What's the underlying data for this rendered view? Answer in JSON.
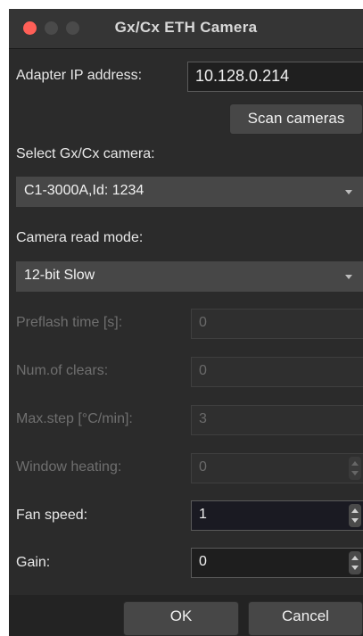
{
  "window": {
    "title": "Gx/Cx ETH Camera"
  },
  "adapter": {
    "label": "Adapter IP address:",
    "value": "10.128.0.214"
  },
  "scan_button_label": "Scan cameras",
  "camera_select": {
    "label": "Select Gx/Cx camera:",
    "selected": "C1-3000A,Id: 1234"
  },
  "read_mode": {
    "label": "Camera read mode:",
    "selected": "12-bit Slow"
  },
  "fields": {
    "preflash": {
      "label": "Preflash time [s]:",
      "value": "0"
    },
    "clears": {
      "label": "Num.of clears:",
      "value": "0"
    },
    "max_step": {
      "label": "Max.step [°C/min]:",
      "value": "3"
    },
    "window_heating": {
      "label": "Window heating:",
      "value": "0"
    },
    "fan_speed": {
      "label": "Fan speed:",
      "value": "1"
    },
    "gain": {
      "label": "Gain:",
      "value": "0"
    }
  },
  "buttons": {
    "ok": "OK",
    "cancel": "Cancel"
  },
  "colors": {
    "background": "#2b2b2b",
    "close_button": "#ff5f57",
    "control": "#474747",
    "disabled_text": "#6f6f6f"
  }
}
